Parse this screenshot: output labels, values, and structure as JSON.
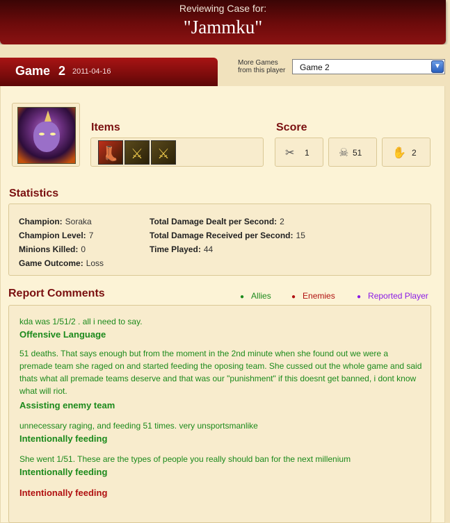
{
  "header": {
    "subtitle": "Reviewing Case for:",
    "title": "\"Jammku\""
  },
  "game": {
    "label": "Game",
    "number": "2",
    "date": "2011-04-16",
    "more_games_label": "More Games from this player",
    "selected_game": "Game 2"
  },
  "champion": {
    "portrait_icon": "soraka-portrait"
  },
  "items": {
    "title": "Items",
    "list": [
      {
        "name": "boots-item-icon",
        "glyph": "👢"
      },
      {
        "name": "sword-item-icon",
        "glyph": "⚔"
      },
      {
        "name": "sword-item-icon",
        "glyph": "⚔"
      }
    ]
  },
  "score": {
    "title": "Score",
    "kills": "1",
    "deaths": "51",
    "assists": "2",
    "kills_icon": "✂",
    "deaths_icon": "☠",
    "assists_icon": "✋"
  },
  "statistics": {
    "title": "Statistics",
    "champion_label": "Champion:",
    "champion_value": "Soraka",
    "level_label": "Champion Level:",
    "level_value": "7",
    "minions_label": "Minions Killed:",
    "minions_value": "0",
    "outcome_label": "Game Outcome:",
    "outcome_value": "Loss",
    "dmg_dealt_label": "Total Damage Dealt per Second:",
    "dmg_dealt_value": "2",
    "dmg_received_label": "Total Damage Received per Second:",
    "dmg_received_value": "15",
    "time_played_label": "Time Played:",
    "time_played_value": "44"
  },
  "comments": {
    "title": "Report Comments",
    "legend": {
      "allies": "Allies",
      "enemies": "Enemies",
      "reported": "Reported Player",
      "allies_color": "#1c8a1c",
      "enemies_color": "#b01010",
      "reported_color": "#8a1ae6"
    },
    "entries": [
      {
        "text": "kda was 1/51/2 . all i need to say.",
        "category": "Offensive Language"
      },
      {
        "text": "51 deaths. That says enough but from the moment in the 2nd minute when she found out we were a premade team she raged on and started feeding the oposing team. She cussed out the whole game and said thats what all premade teams deserve and that was our \"punishment\" if this doesnt get banned, i dont know what will riot.",
        "category": "Assisting enemy team"
      },
      {
        "text": "unnecessary raging, and feeding 51 times. very unsportsmanlike",
        "category": "Intentionally feeding"
      },
      {
        "text": "She went 1/51. These are the types of people you really should ban for the next millenium",
        "category": "Intentionally feeding"
      },
      {
        "text": "",
        "category": "Intentionally feeding"
      }
    ]
  }
}
